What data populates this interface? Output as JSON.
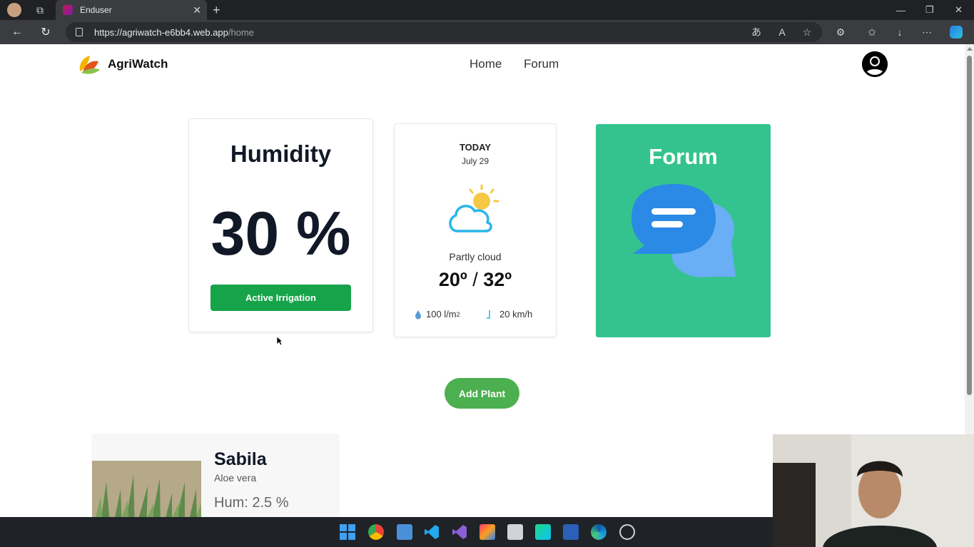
{
  "browser": {
    "tab_title": "Enduser",
    "url_host": "https://agriwatch-e6bb4.web.app",
    "url_path": "/home"
  },
  "header": {
    "brand": "AgriWatch",
    "nav": [
      "Home",
      "Forum"
    ]
  },
  "humidity": {
    "title": "Humidity",
    "value": "30 %",
    "button": "Active Irrigation"
  },
  "weather": {
    "day": "TODAY",
    "date": "July 29",
    "condition": "Partly cloud",
    "temp_min": "20º",
    "temp_sep": "/",
    "temp_max": "32º",
    "rain": "100 l/m",
    "rain_sup": "2",
    "wind": "20 km/h",
    "icon": "partly-cloudy-icon"
  },
  "forum": {
    "title": "Forum",
    "icon": "chat-bubbles-icon"
  },
  "add_plant": "Add Plant",
  "plant": {
    "name": "Sabila",
    "scientific": "Aloe vera",
    "humidity": "Hum: 2.5 %"
  },
  "colors": {
    "accent": "#16a34a",
    "forum_bg": "#34c38f",
    "add_button": "#4caf50"
  }
}
